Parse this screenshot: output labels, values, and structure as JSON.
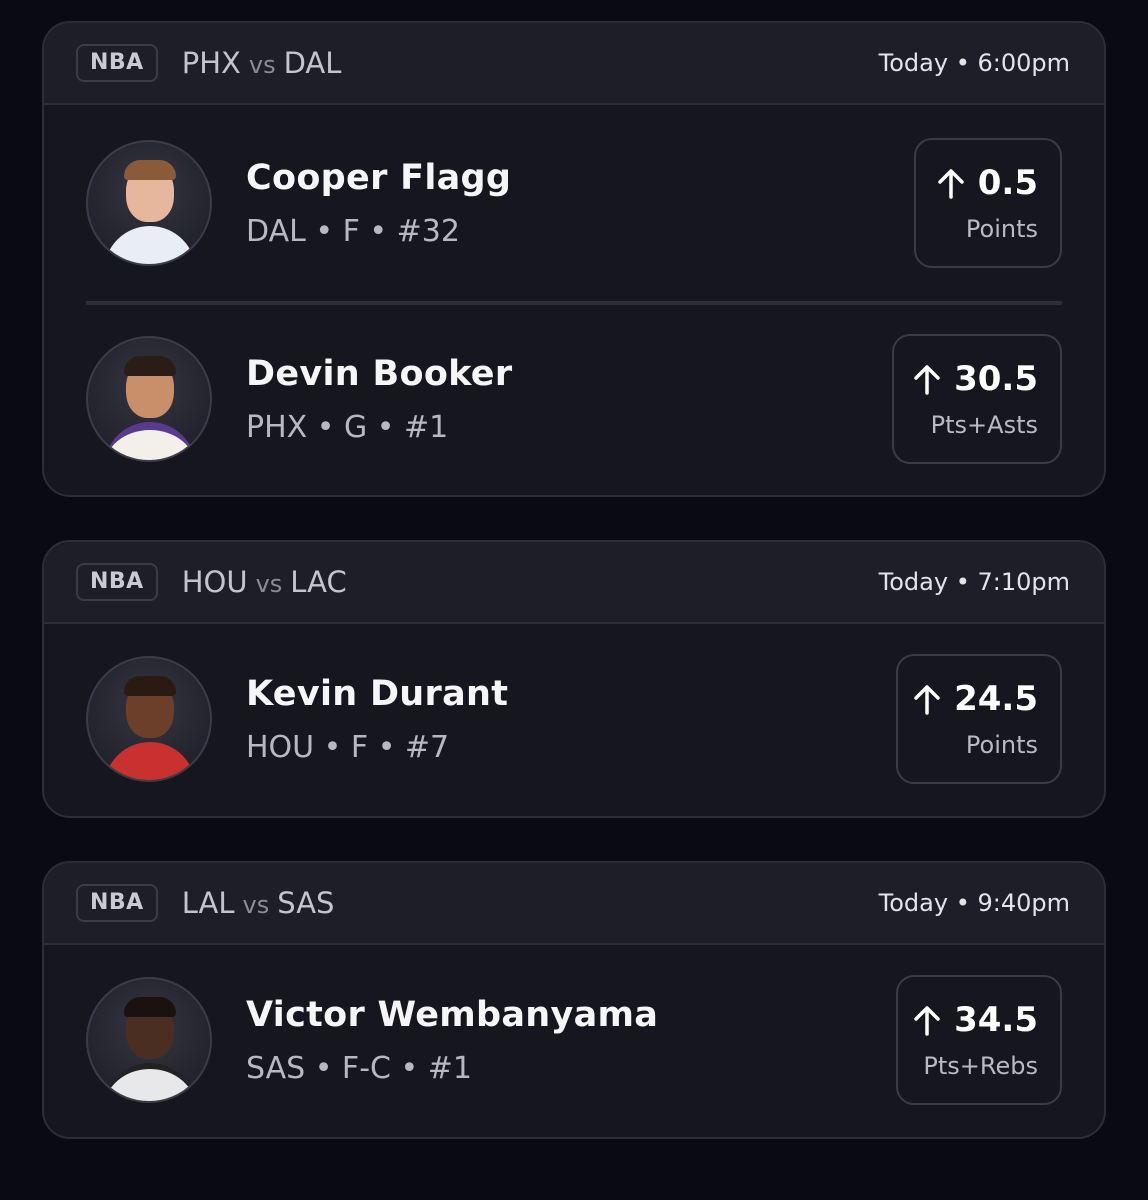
{
  "games": [
    {
      "league": "NBA",
      "home": "PHX",
      "vs": "vs",
      "away": "DAL",
      "time": "Today • 6:00pm",
      "players": [
        {
          "name": "Cooper Flagg",
          "meta": "DAL • F • #32",
          "line": "0.5",
          "stat": "Points"
        },
        {
          "name": "Devin Booker",
          "meta": "PHX • G • #1",
          "line": "30.5",
          "stat": "Pts+Asts"
        }
      ]
    },
    {
      "league": "NBA",
      "home": "HOU",
      "vs": "vs",
      "away": "LAC",
      "time": "Today • 7:10pm",
      "players": [
        {
          "name": "Kevin Durant",
          "meta": "HOU • F • #7",
          "line": "24.5",
          "stat": "Points"
        }
      ]
    },
    {
      "league": "NBA",
      "home": "LAL",
      "vs": "vs",
      "away": "SAS",
      "time": "Today • 9:40pm",
      "players": [
        {
          "name": "Victor Wembanyama",
          "meta": "SAS • F-C • #1",
          "line": "34.5",
          "stat": "Pts+Rebs"
        }
      ]
    }
  ],
  "icons": {
    "arrow": "arrow-up-icon",
    "avatar": "player-headshot"
  },
  "colors": {
    "background": "#0a0b12",
    "card": "#15161e",
    "header": "#1d1e27",
    "border": "#2c2d37"
  }
}
